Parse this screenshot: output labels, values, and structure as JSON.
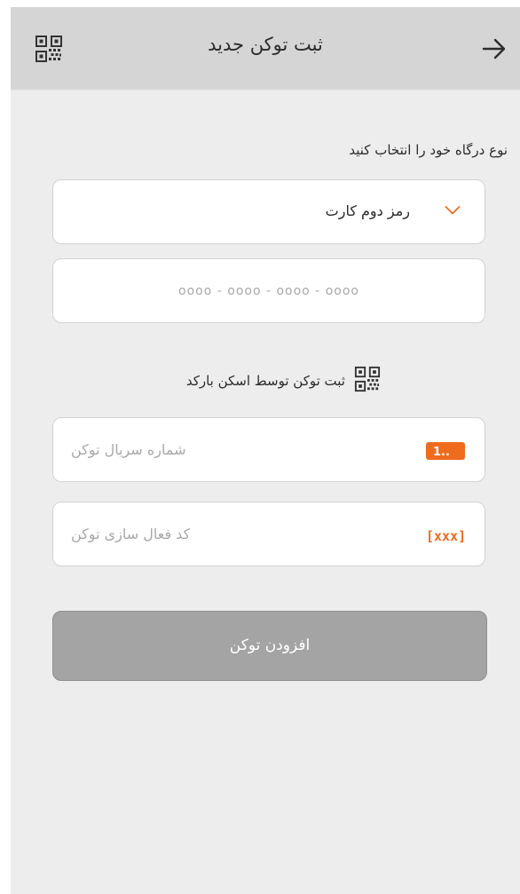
{
  "header": {
    "title": "ثبت توکن جدید",
    "back_icon": "arrow-right-icon",
    "qr_icon": "qr-code-icon",
    "background": "#d5d5d5"
  },
  "gateway": {
    "label": "نوع درگاه خود را انتخاب کنید",
    "selected_value": "رمز دوم کارت",
    "dropdown_icon": "chevron-down-icon",
    "accent_color": "#ef6c1f"
  },
  "card_number": {
    "placeholder": "oooo - oooo - oooo - oooo"
  },
  "scan": {
    "label": "ثبت توکن توسط اسکن بارکد",
    "icon": "qr-code-icon"
  },
  "serial": {
    "placeholder": "شماره سریال توکن",
    "icon": "serial-number-icon",
    "icon_text": "1.."
  },
  "activation_code": {
    "placeholder": "کد فعال سازی توکن",
    "icon": "activation-code-icon",
    "icon_text": "[xxx]"
  },
  "submit": {
    "label": "افزودن توکن",
    "state": "disabled",
    "background": "#a4a4a4"
  }
}
